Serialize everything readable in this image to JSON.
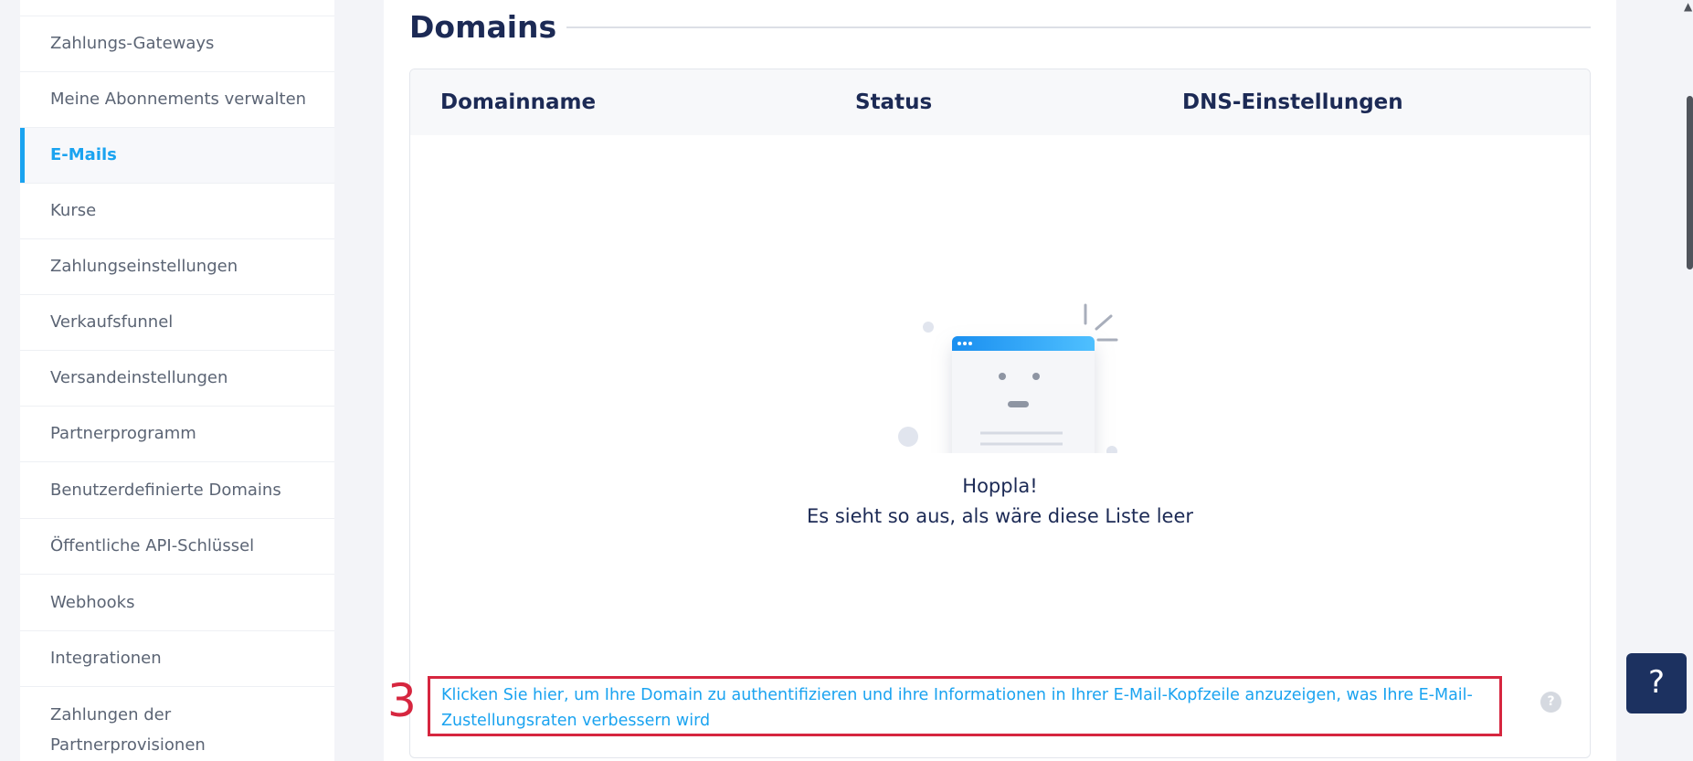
{
  "sidebar": {
    "items": [
      {
        "label": "Zahlungs-Gateways",
        "active": false
      },
      {
        "label": "Meine Abonnements verwalten",
        "active": false
      },
      {
        "label": "E-Mails",
        "active": true
      },
      {
        "label": "Kurse",
        "active": false
      },
      {
        "label": "Zahlungseinstellungen",
        "active": false
      },
      {
        "label": "Verkaufsfunnel",
        "active": false
      },
      {
        "label": "Versandeinstellungen",
        "active": false
      },
      {
        "label": "Partnerprogramm",
        "active": false
      },
      {
        "label": "Benutzerdefinierte Domains",
        "active": false
      },
      {
        "label": "Öffentliche API-Schlüssel",
        "active": false
      },
      {
        "label": "Webhooks",
        "active": false
      },
      {
        "label": "Integrationen",
        "active": false
      },
      {
        "label": "Zahlungen der Partnerprovisionen",
        "active": false
      }
    ]
  },
  "main": {
    "title": "Domains",
    "table": {
      "columns": [
        "Domainname",
        "Status",
        "DNS-Einstellungen"
      ]
    },
    "empty_state": {
      "title": "Hoppla!",
      "message": "Es sieht so aus, als wäre diese Liste leer"
    },
    "auth_link": "Klicken Sie hier, um Ihre Domain zu authentifizieren und ihre Informationen in Ihrer E-Mail-Kopfzeile anzuzeigen, was Ihre E-Mail-Zustellungsraten verbessern wird",
    "annotation_number": "3",
    "help_icon": "?"
  },
  "help_fab": "?",
  "colors": {
    "accent": "#1aa3f0",
    "heading": "#1c2a55",
    "annotation": "#d6263f",
    "fab": "#1c3160"
  }
}
